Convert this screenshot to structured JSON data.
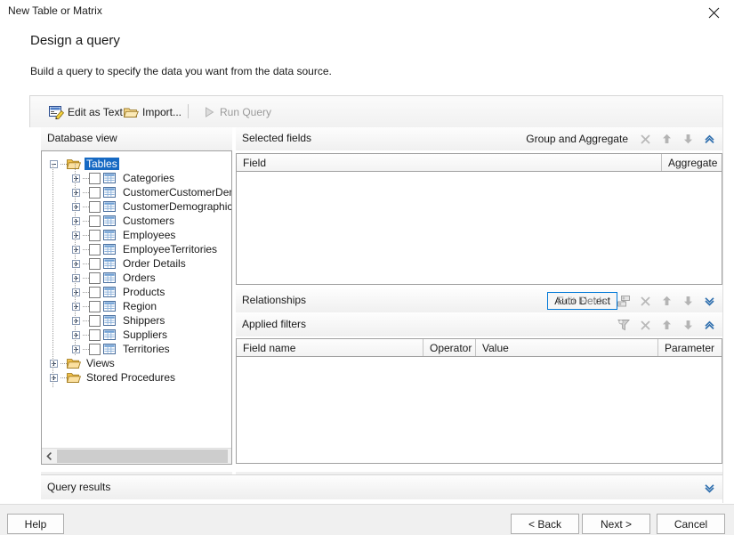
{
  "window": {
    "title": "New Table or Matrix",
    "close_icon": "close-icon"
  },
  "header": {
    "title": "Design a query",
    "subtitle": "Build a query to specify the data you want from the data source."
  },
  "toolbar": {
    "edit_as_text": "Edit as Text",
    "import": "Import...",
    "run_query": "Run Query"
  },
  "database_view": {
    "title": "Database view",
    "tree": [
      {
        "label": "Tables",
        "type": "folder",
        "expander": "minus",
        "selected": true,
        "depth": 0,
        "checkbox": false
      },
      {
        "label": "Categories",
        "type": "table",
        "expander": "plus",
        "selected": false,
        "depth": 1,
        "checkbox": true
      },
      {
        "label": "CustomerCustomerDemo",
        "type": "table",
        "expander": "plus",
        "selected": false,
        "depth": 1,
        "checkbox": true
      },
      {
        "label": "CustomerDemographics",
        "type": "table",
        "expander": "plus",
        "selected": false,
        "depth": 1,
        "checkbox": true
      },
      {
        "label": "Customers",
        "type": "table",
        "expander": "plus",
        "selected": false,
        "depth": 1,
        "checkbox": true
      },
      {
        "label": "Employees",
        "type": "table",
        "expander": "plus",
        "selected": false,
        "depth": 1,
        "checkbox": true
      },
      {
        "label": "EmployeeTerritories",
        "type": "table",
        "expander": "plus",
        "selected": false,
        "depth": 1,
        "checkbox": true
      },
      {
        "label": "Order Details",
        "type": "table",
        "expander": "plus",
        "selected": false,
        "depth": 1,
        "checkbox": true
      },
      {
        "label": "Orders",
        "type": "table",
        "expander": "plus",
        "selected": false,
        "depth": 1,
        "checkbox": true
      },
      {
        "label": "Products",
        "type": "table",
        "expander": "plus",
        "selected": false,
        "depth": 1,
        "checkbox": true
      },
      {
        "label": "Region",
        "type": "table",
        "expander": "plus",
        "selected": false,
        "depth": 1,
        "checkbox": true
      },
      {
        "label": "Shippers",
        "type": "table",
        "expander": "plus",
        "selected": false,
        "depth": 1,
        "checkbox": true
      },
      {
        "label": "Suppliers",
        "type": "table",
        "expander": "plus",
        "selected": false,
        "depth": 1,
        "checkbox": true
      },
      {
        "label": "Territories",
        "type": "table",
        "expander": "plus",
        "selected": false,
        "depth": 1,
        "checkbox": true
      },
      {
        "label": "Views",
        "type": "folder",
        "expander": "plus",
        "selected": false,
        "depth": 0,
        "checkbox": false
      },
      {
        "label": "Stored Procedures",
        "type": "folder",
        "expander": "plus",
        "selected": false,
        "depth": 0,
        "checkbox": false
      }
    ],
    "scroll_left_icon": "chevron-left-icon",
    "scroll_right_icon": "chevron-right-icon"
  },
  "selected_fields": {
    "title": "Selected fields",
    "group_and_aggregate": "Group and Aggregate",
    "actions": [
      "delete-icon",
      "move-up-icon",
      "move-down-icon",
      "collapse-icon"
    ],
    "columns": [
      "Field",
      "Aggregate"
    ],
    "rows": []
  },
  "relationships": {
    "title": "Relationships",
    "auto_detect": "Auto Detect",
    "edit_fields": "Edit Fields",
    "actions": [
      "add-relationship-icon",
      "delete-icon",
      "move-up-icon",
      "move-down-icon",
      "expand-icon"
    ]
  },
  "applied_filters": {
    "title": "Applied filters",
    "actions": [
      "filter-icon",
      "delete-icon",
      "move-up-icon",
      "move-down-icon",
      "collapse-icon"
    ],
    "columns": [
      "Field name",
      "Operator",
      "Value",
      "Parameter"
    ],
    "rows": []
  },
  "query_results": {
    "title": "Query results",
    "expand_icon": "expand-icon"
  },
  "footer": {
    "help": "Help",
    "back": "< Back",
    "next": "Next >",
    "cancel": "Cancel"
  },
  "colors": {
    "accent": "#0078d7",
    "selection": "#1669c3",
    "chevron": "#2f6fae",
    "panel_border": "#a0a0a0"
  }
}
